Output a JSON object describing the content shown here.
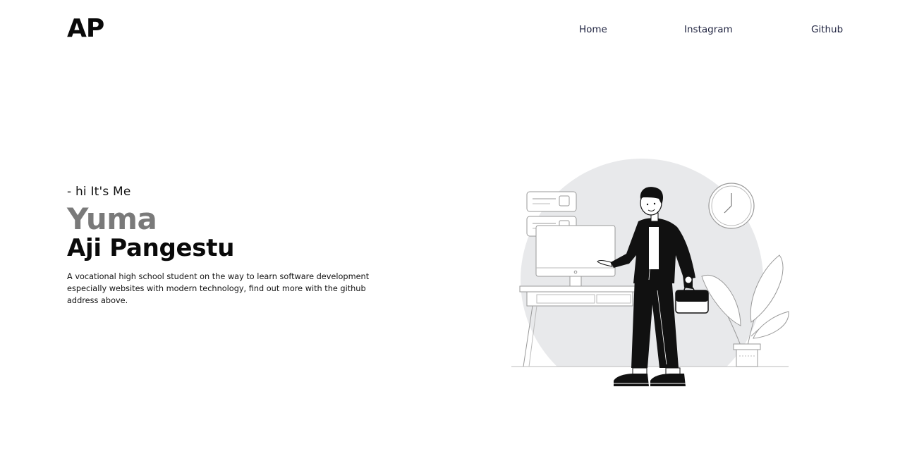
{
  "header": {
    "logo": "AP",
    "nav": [
      {
        "label": "Home"
      },
      {
        "label": "Instagram"
      },
      {
        "label": "Github"
      }
    ]
  },
  "hero": {
    "greeting": "- hi It's Me",
    "first_name": "Yuma",
    "last_name": "Aji Pangestu",
    "description": "A vocational high school student on the way to learn software development especially websites with modern technology, find out more with the github address above."
  },
  "colors": {
    "text": "#0a0a0a",
    "first_name": "#7a7a7a",
    "nav": "#1f2340",
    "illustration_bg": "#e8e9eb"
  }
}
